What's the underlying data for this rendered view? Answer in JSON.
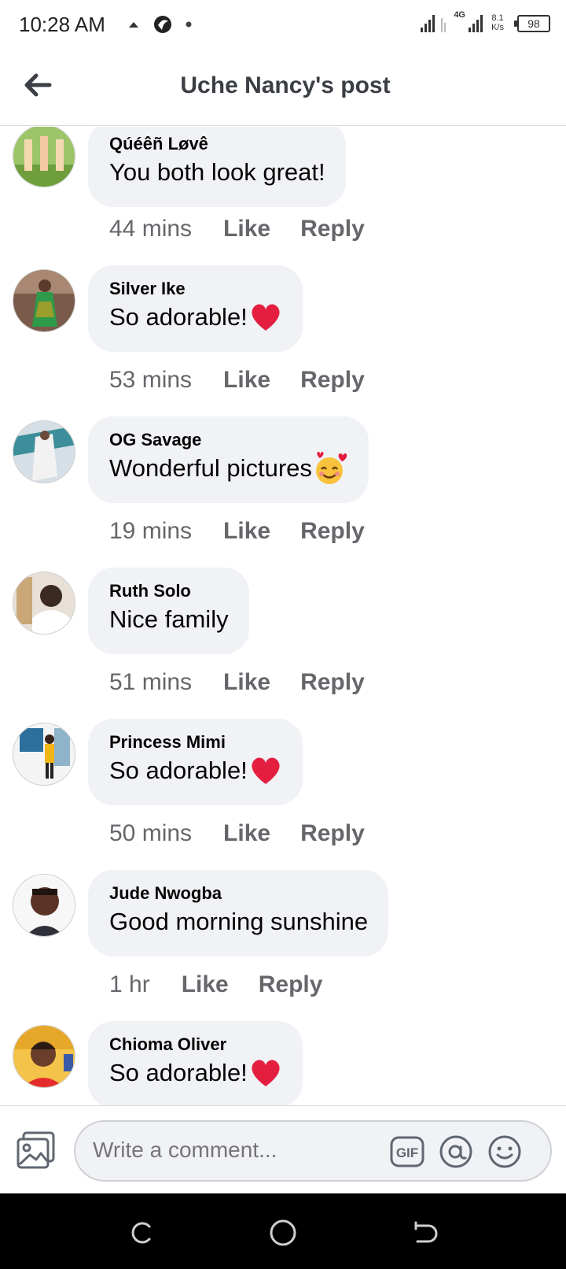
{
  "status_bar": {
    "time": "10:28 AM",
    "network_type": "4G",
    "speed_value": "8.1",
    "speed_unit": "K/s",
    "battery": "98"
  },
  "header": {
    "title": "Uche Nancy's post",
    "back_icon": "arrow-left-icon"
  },
  "comments": [
    {
      "name": "Qúéêñ Løvê",
      "text": "You both look great!",
      "emoji": "",
      "time": "44 mins",
      "like": "Like",
      "reply": "Reply"
    },
    {
      "name": "Silver Ike",
      "text": "So adorable!",
      "emoji": "heart-icon",
      "time": "53 mins",
      "like": "Like",
      "reply": "Reply"
    },
    {
      "name": "OG Savage",
      "text": "Wonderful pictures",
      "emoji": "smiling-face-with-hearts-icon",
      "time": "19 mins",
      "like": "Like",
      "reply": "Reply"
    },
    {
      "name": "Ruth Solo",
      "text": "Nice family",
      "emoji": "",
      "time": "51 mins",
      "like": "Like",
      "reply": "Reply"
    },
    {
      "name": "Princess Mimi",
      "text": "So adorable!",
      "emoji": "heart-icon",
      "time": "50 mins",
      "like": "Like",
      "reply": "Reply"
    },
    {
      "name": "Jude Nwogba",
      "text": "Good morning sunshine",
      "emoji": "",
      "time": "1 hr",
      "like": "Like",
      "reply": "Reply"
    },
    {
      "name": "Chioma Oliver",
      "text": "So adorable!",
      "emoji": "heart-icon",
      "time": "",
      "like": "",
      "reply": ""
    }
  ],
  "composer": {
    "placeholder": "Write a comment...",
    "gif_label": "GIF",
    "icons": [
      "photo-icon",
      "gif-icon",
      "mention-icon",
      "emoji-icon"
    ]
  },
  "colors": {
    "bubble": "#f0f2f5",
    "secondary_text": "#65676b",
    "heart": "#e41e3f",
    "divider": "#dadde1"
  }
}
